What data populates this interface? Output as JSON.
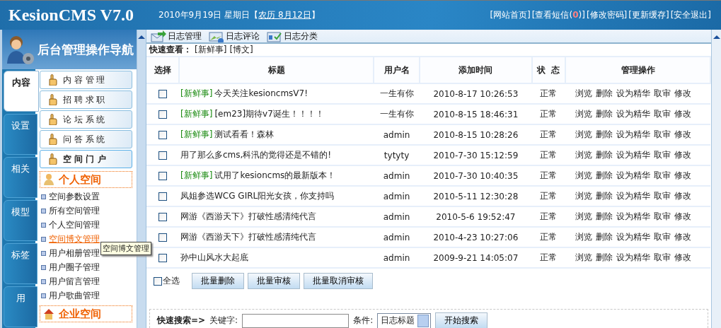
{
  "header": {
    "logo": "KesionCMS V7.0",
    "date": "2010年9月19日  星期日【",
    "lunar": "农历 8月12日",
    "date_end": "】",
    "links": [
      {
        "label": "[网站首页]"
      },
      {
        "label": "[查看短信(",
        "count": "0",
        "end": ")]"
      },
      {
        "label": "[修改密码]"
      },
      {
        "label": "[更新缓存]"
      },
      {
        "label": "[安全退出]"
      }
    ]
  },
  "sidebar": {
    "title": "后台管理操作导航",
    "tabs": [
      {
        "label": "内容",
        "selected": true
      },
      {
        "label": "设置",
        "selected": false
      },
      {
        "label": "相关",
        "selected": false
      },
      {
        "label": "模型",
        "selected": false
      },
      {
        "label": "标签",
        "selected": false
      },
      {
        "label": "用",
        "selected": false
      }
    ],
    "menus": [
      {
        "label": "内 容 管 理",
        "selected": false
      },
      {
        "label": "招 聘 求 职",
        "selected": false
      },
      {
        "label": "论 坛 系 统",
        "selected": false
      },
      {
        "label": "问 答 系 统",
        "selected": false
      },
      {
        "label": "空 间 门 户",
        "selected": true
      }
    ],
    "sections": [
      {
        "title": "个人空间",
        "items": [
          {
            "label": "空间参数设置",
            "selected": false
          },
          {
            "label": "所有空间管理",
            "selected": false
          },
          {
            "label": "个人空间管理",
            "selected": false
          },
          {
            "label": "空间博文管理",
            "selected": true
          },
          {
            "label": "用户相册管理",
            "selected": false
          },
          {
            "label": "用户圈子管理",
            "selected": false
          },
          {
            "label": "用户留言管理",
            "selected": false
          },
          {
            "label": "用户歌曲管理",
            "selected": false
          }
        ]
      },
      {
        "title": "企业空间"
      }
    ],
    "tooltip": "空间博文管理"
  },
  "toolbar": [
    {
      "label": "日志管理",
      "kind": "send"
    },
    {
      "label": "日志评论",
      "kind": "comment"
    },
    {
      "label": "日志分类",
      "kind": "category"
    }
  ],
  "quick_view": {
    "label": "快速查看：",
    "links": [
      "[新鲜事]",
      "[博文]"
    ]
  },
  "table": {
    "columns": [
      "选择",
      "标题",
      "用户名",
      "添加时间",
      "状  态",
      "管理操作"
    ],
    "rows": [
      {
        "checked": false,
        "tag": "[新鲜事]",
        "title": "今天关注kesioncmsV7!",
        "user": "一生有你",
        "time": "2010-8-17 10:26:53",
        "status": "正常",
        "actions": [
          "浏览",
          "删除",
          "设为精华",
          "取审",
          "修改"
        ]
      },
      {
        "checked": false,
        "tag": "[新鲜事]",
        "title": "[em23]期待v7诞生！！！！",
        "user": "一生有你",
        "time": "2010-8-15 18:46:31",
        "status": "正常",
        "actions": [
          "浏览",
          "删除",
          "设为精华",
          "取审",
          "修改"
        ]
      },
      {
        "checked": false,
        "tag": "[新鲜事]",
        "title": "测试看看！森林",
        "user": "admin",
        "time": "2010-8-15 10:28:26",
        "status": "正常",
        "actions": [
          "浏览",
          "删除",
          "设为精华",
          "取审",
          "修改"
        ]
      },
      {
        "checked": false,
        "title": "用了那么多cms,科汛的觉得还是不错的!",
        "user": "tytyty",
        "time": "2010-7-30 15:12:59",
        "status": "正常",
        "actions": [
          "浏览",
          "删除",
          "设为精华",
          "取审",
          "修改"
        ]
      },
      {
        "checked": false,
        "tag": "[新鲜事]",
        "title": "试用了kesioncms的最新版本！",
        "user": "admin",
        "time": "2010-7-30 10:40:35",
        "status": "正常",
        "actions": [
          "浏览",
          "删除",
          "设为精华",
          "取审",
          "修改"
        ]
      },
      {
        "checked": false,
        "title": "凤姐参选WCG GIRL阳光女孩，你支持吗",
        "user": "admin",
        "time": "2010-5-11 12:30:28",
        "status": "正常",
        "actions": [
          "浏览",
          "删除",
          "设为精华",
          "取审",
          "修改"
        ]
      },
      {
        "checked": false,
        "title": "网游《西游天下》打破性感清纯代言",
        "user": "admin",
        "time": "2010-5-6 19:52:47",
        "status": "正常",
        "actions": [
          "浏览",
          "删除",
          "设为精华",
          "取审",
          "修改"
        ]
      },
      {
        "checked": false,
        "title": "网游《西游天下》打破性感清纯代言",
        "user": "admin",
        "time": "2010-4-23 10:27:06",
        "status": "正常",
        "actions": [
          "浏览",
          "删除",
          "设为精华",
          "取审",
          "修改"
        ]
      },
      {
        "checked": false,
        "title": "孙中山风水大起底",
        "user": "admin",
        "time": "2009-9-21 14:05:07",
        "status": "正常",
        "actions": [
          "浏览",
          "删除",
          "设为精华",
          "取审",
          "修改"
        ]
      }
    ]
  },
  "bulk": {
    "select_all": {
      "label": "全选",
      "checked": false
    },
    "buttons": [
      "批量删除",
      "批量审核",
      "批量取消审核"
    ]
  },
  "search": {
    "label": "快速搜索=>",
    "keyword_label": "关键字:",
    "condition_label": "条件:",
    "condition": "日志标题",
    "button": "开始搜索"
  }
}
